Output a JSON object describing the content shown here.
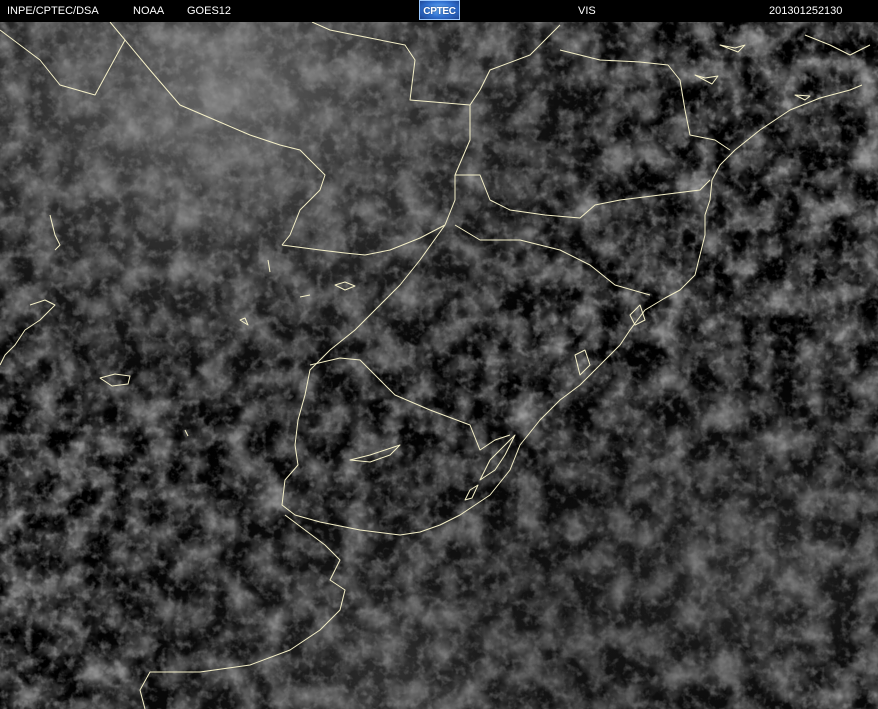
{
  "header": {
    "source": "INPE/CPTEC/DSA",
    "agency": "NOAA",
    "satellite": "GOES12",
    "channel": "VIS",
    "timestamp": "201301252130"
  },
  "logo": {
    "text": "CPTEC",
    "color": "#2f6fcf"
  },
  "map": {
    "imagery_type": "visible satellite image",
    "region": "southern Brazil, Uruguay, northeastern Argentina and adjacent South Atlantic",
    "border_color": "#f5f0c8",
    "cloud_color": "#9a9a9a",
    "background_color": "#000000"
  }
}
